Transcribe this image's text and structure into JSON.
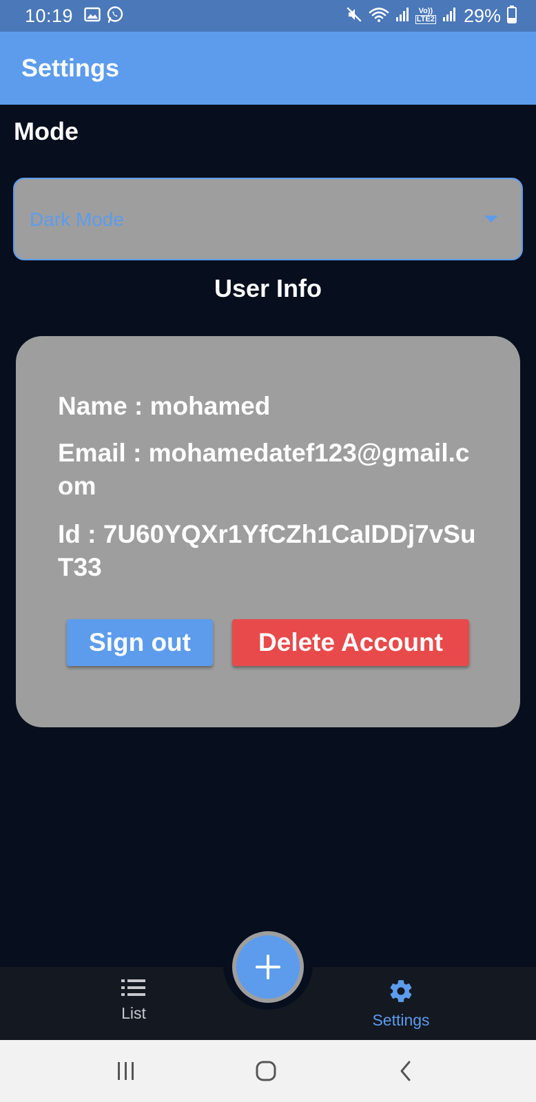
{
  "status_bar": {
    "time": "10:19",
    "battery_percent": "29%",
    "left_icons": [
      "gallery-icon",
      "whatsapp-icon"
    ],
    "right_icons": [
      "mute-icon",
      "wifi-icon",
      "signal-icon",
      "volte-lte2-icon",
      "signal-icon",
      "battery-icon"
    ],
    "volte_label": "Vo))",
    "lte_label": "LTE2"
  },
  "app_bar": {
    "title": "Settings"
  },
  "mode_section": {
    "heading": "Mode",
    "selected_value": "Dark Mode",
    "dropdown_icon": "arrow-drop-down-icon"
  },
  "user_info": {
    "heading": "User Info",
    "name_line": "Name : mohamed",
    "email_line": "Email : mohamedatef123@gmail.com",
    "id_line": "Id : 7U60YQXr1YfCZh1CaIDDj7vSuT33",
    "sign_out_label": "Sign out",
    "delete_label": "Delete Account"
  },
  "fab": {
    "icon": "plus-icon"
  },
  "bottom_nav": {
    "items": [
      {
        "label": "List",
        "icon": "list-icon",
        "active": false
      },
      {
        "label": "Settings",
        "icon": "gear-icon",
        "active": true
      }
    ]
  },
  "system_nav": {
    "buttons": [
      "recent-apps-icon",
      "home-icon",
      "back-icon"
    ]
  },
  "colors": {
    "primary": "#5d9cec",
    "status_bar": "#4a78b9",
    "background": "#070e1d",
    "card": "#9e9e9e",
    "danger": "#e84a4c",
    "bottom_nav": "#141821"
  }
}
